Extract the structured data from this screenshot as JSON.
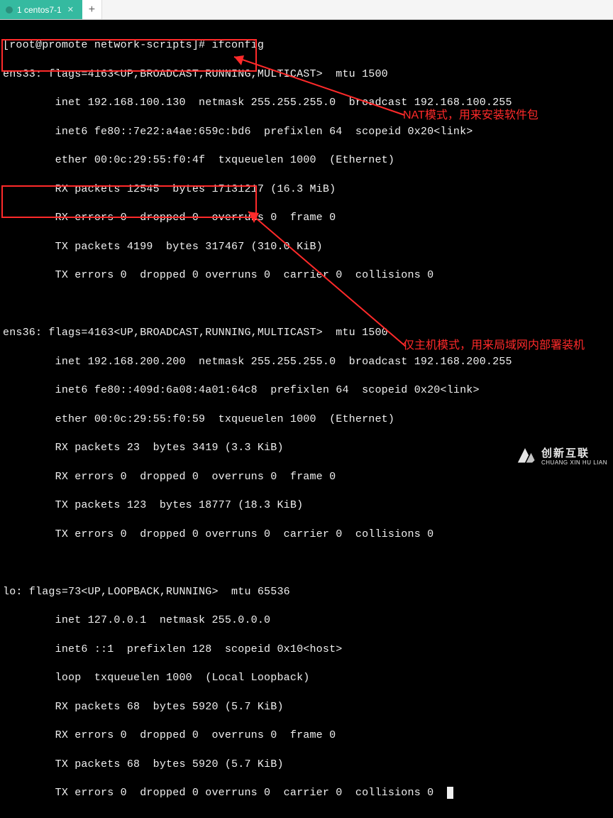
{
  "tabbar": {
    "active_tab_label": "1 centos7-1",
    "newtab_label": "+"
  },
  "terminal": {
    "prompt": "[root@promote network-scripts]# ",
    "command": "ifconfig",
    "if1": {
      "header": "ens33: flags=4163<UP,BROADCAST,RUNNING,MULTICAST>  mtu 1500",
      "inet": "        inet 192.168.100.130  netmask 255.255.255.0  broadcast 192.168.100.255",
      "inet6": "        inet6 fe80::7e22:a4ae:659c:bd6  prefixlen 64  scopeid 0x20<link>",
      "ether": "        ether 00:0c:29:55:f0:4f  txqueuelen 1000  (Ethernet)",
      "rxp": "        RX packets 12545  bytes 17131217 (16.3 MiB)",
      "rxe": "        RX errors 0  dropped 0  overruns 0  frame 0",
      "txp": "        TX packets 4199  bytes 317467 (310.0 KiB)",
      "txe": "        TX errors 0  dropped 0 overruns 0  carrier 0  collisions 0"
    },
    "if2": {
      "header": "ens36: flags=4163<UP,BROADCAST,RUNNING,MULTICAST>  mtu 1500",
      "inet": "        inet 192.168.200.200  netmask 255.255.255.0  broadcast 192.168.200.255",
      "inet6": "        inet6 fe80::409d:6a08:4a01:64c8  prefixlen 64  scopeid 0x20<link>",
      "ether": "        ether 00:0c:29:55:f0:59  txqueuelen 1000  (Ethernet)",
      "rxp": "        RX packets 23  bytes 3419 (3.3 KiB)",
      "rxe": "        RX errors 0  dropped 0  overruns 0  frame 0",
      "txp": "        TX packets 123  bytes 18777 (18.3 KiB)",
      "txe": "        TX errors 0  dropped 0 overruns 0  carrier 0  collisions 0"
    },
    "lo": {
      "header": "lo: flags=73<UP,LOOPBACK,RUNNING>  mtu 65536",
      "inet": "        inet 127.0.0.1  netmask 255.0.0.0",
      "inet6": "        inet6 ::1  prefixlen 128  scopeid 0x10<host>",
      "loop": "        loop  txqueuelen 1000  (Local Loopback)",
      "rxp": "        RX packets 68  bytes 5920 (5.7 KiB)",
      "rxe": "        RX errors 0  dropped 0  overruns 0  frame 0",
      "txp": "        TX packets 68  bytes 5920 (5.7 KiB)",
      "txe": "        TX errors 0  dropped 0 overruns 0  carrier 0  collisions 0"
    }
  },
  "annotations": {
    "note1": "NAT模式，用来安装软件包",
    "note2": "仅主机模式，用来局域网内部署装机"
  },
  "watermark": {
    "cn": "创新互联",
    "en": "CHUANG XIN HU LIAN"
  }
}
